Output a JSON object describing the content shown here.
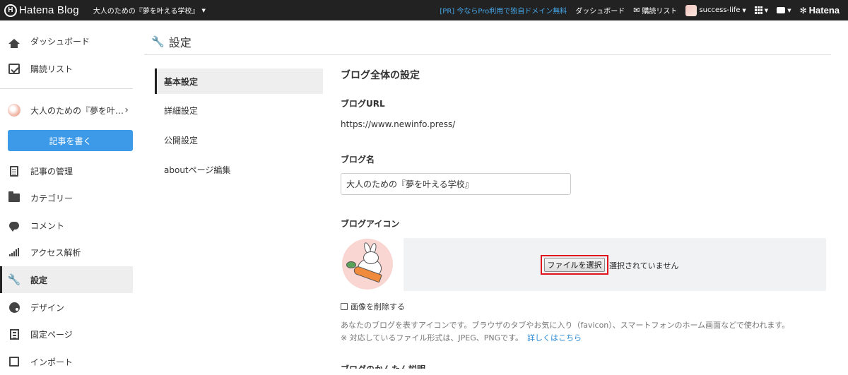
{
  "topbar": {
    "logo_text": "Hatena Blog",
    "blog_selector": "大人のための『夢を叶える学校』",
    "pr_link": "[PR] 今ならPro利用で独自ドメイン無料",
    "dashboard": "ダッシュボード",
    "reading_list": "購読リスト",
    "user": "success-life",
    "brand": "Hatena"
  },
  "sidebar": {
    "dashboard": "ダッシュボード",
    "reading_list": "購読リスト",
    "blog_name": "大人のための『夢を叶…",
    "write_button": "記事を書く",
    "items": [
      {
        "label": "記事の管理",
        "icon": "document-icon"
      },
      {
        "label": "カテゴリー",
        "icon": "folder-icon"
      },
      {
        "label": "コメント",
        "icon": "comment-icon"
      },
      {
        "label": "アクセス解析",
        "icon": "bar-chart-icon"
      },
      {
        "label": "設定",
        "icon": "wrench-icon",
        "active": true
      },
      {
        "label": "デザイン",
        "icon": "palette-icon"
      },
      {
        "label": "固定ページ",
        "icon": "pages-icon"
      },
      {
        "label": "インポート",
        "icon": "import-icon"
      }
    ]
  },
  "main": {
    "title": "設定",
    "subnav": [
      "基本設定",
      "詳細設定",
      "公開設定",
      "aboutページ編集"
    ],
    "section_title": "ブログ全体の設定",
    "blog_url_label": "ブログURL",
    "blog_url_value": "https://www.newinfo.press/",
    "blog_name_label": "ブログ名",
    "blog_name_value": "大人のための『夢を叶える学校』",
    "blog_icon_label": "ブログアイコン",
    "file_button": "ファイルを選択",
    "no_file_text": "選択されていません",
    "delete_image_label": "画像を削除する",
    "help_text_1": "あなたのブログを表すアイコンです。ブラウザのタブやお気に入り（favicon）、スマートフォンのホーム画面などで使われます。",
    "help_text_2": "※ 対応しているファイル形式は、JPEG、PNGです。",
    "help_link": "詳しくはこちら",
    "next_label_cut": "ブログのかんたん説明"
  },
  "colors": {
    "topbar_bg": "#222222",
    "write_button": "#3d9ae8",
    "pr_link": "#45a6e8",
    "highlight_border": "#e0141e",
    "link": "#2a8bd6"
  }
}
